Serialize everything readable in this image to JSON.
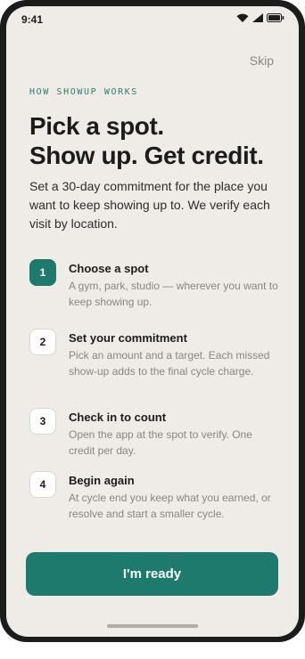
{
  "status_bar": {
    "time": "9:41",
    "icons": [
      "wifi-icon",
      "cellular-icon",
      "battery-icon"
    ]
  },
  "header": {
    "skip_label": "Skip"
  },
  "eyebrow": "HOW SHOWUP WORKS",
  "headline": {
    "line1": "Pick a spot.",
    "line2": "Show up. Get credit."
  },
  "intro": "Set a 30-day commitment for the place you want to keep showing up to. We verify each visit by location.",
  "steps": [
    {
      "number": "1",
      "title": "Choose a spot",
      "description": "A gym, park, studio — wherever you want to keep showing up."
    },
    {
      "number": "2",
      "title": "Set your commitment",
      "description": "Pick an amount and a target. Each missed show-up adds to the final cycle charge."
    },
    {
      "number": "3",
      "title": "Check in to count",
      "description": "Open the app at the spot to verify. One credit per day."
    },
    {
      "number": "4",
      "title": "Begin again",
      "description": "At cycle end you keep what you earned, or resolve and start a smaller cycle."
    }
  ],
  "cta_label": "I'm ready",
  "colors": {
    "accent": "#1d7a6c",
    "background": "#efece7",
    "muted_text": "#8a867f"
  }
}
